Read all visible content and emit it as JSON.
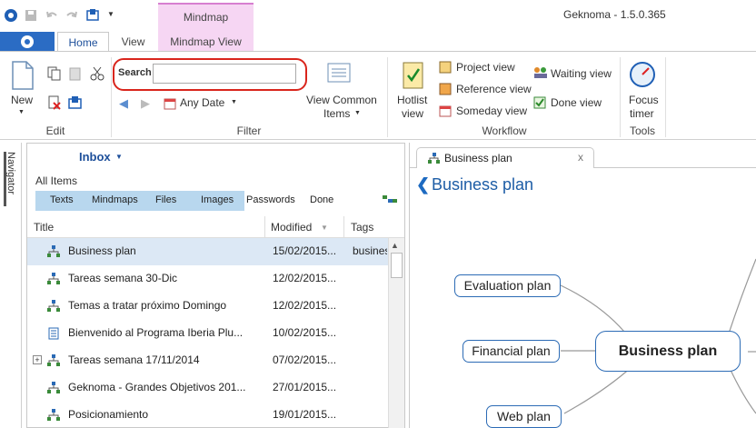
{
  "app": {
    "title": "Geknoma - 1.5.0.365",
    "context_group": "Mindmap"
  },
  "tabs": {
    "home": "Home",
    "view": "View",
    "mindmap_view": "Mindmap View"
  },
  "ribbon": {
    "new_label": "New",
    "edit_group": "Edit",
    "search_label": "Search",
    "search_value": "",
    "any_date": "Any Date",
    "view_common_items_line1": "View Common",
    "view_common_items_line2": "Items",
    "filter_group": "Filter",
    "hotlist_line1": "Hotlist",
    "hotlist_line2": "view",
    "project_view": "Project view",
    "reference_view": "Reference view",
    "someday_view": "Someday view",
    "waiting_view": "Waiting view",
    "done_view": "Done view",
    "workflow_group": "Workflow",
    "focus_line1": "Focus",
    "focus_line2": "timer",
    "tools_group": "Tools"
  },
  "navigator": {
    "label": "Navigator"
  },
  "list": {
    "inbox": "Inbox",
    "all_items": "All Items",
    "filters": [
      "Texts",
      "Mindmaps",
      "Files",
      "Images",
      "Passwords",
      "Done"
    ],
    "columns": {
      "title": "Title",
      "modified": "Modified",
      "tags": "Tags"
    },
    "rows": [
      {
        "title": "Business plan",
        "modified": "15/02/2015...",
        "tags": "busines",
        "icon": "mindmap-icon",
        "selected": true
      },
      {
        "title": "Tareas semana 30-Dic",
        "modified": "12/02/2015...",
        "tags": "",
        "icon": "mindmap-icon"
      },
      {
        "title": "Temas a tratar próximo Domingo",
        "modified": "12/02/2015...",
        "tags": "",
        "icon": "mindmap-icon"
      },
      {
        "title": "Bienvenido al Programa Iberia Plu...",
        "modified": "10/02/2015...",
        "tags": "",
        "icon": "document-icon"
      },
      {
        "title": "Tareas semana 17/11/2014",
        "modified": "07/02/2015...",
        "tags": "",
        "icon": "mindmap-icon",
        "expandable": true
      },
      {
        "title": "Geknoma - Grandes Objetivos 201...",
        "modified": "27/01/2015...",
        "tags": "",
        "icon": "mindmap-icon"
      },
      {
        "title": "Posicionamiento",
        "modified": "19/01/2015...",
        "tags": "",
        "icon": "mindmap-icon"
      }
    ]
  },
  "map": {
    "tab_label": "Business plan",
    "close_glyph": "x",
    "heading": "Business plan",
    "nodes": {
      "center": "Business plan",
      "evaluation": "Evaluation plan",
      "financial": "Financial plan",
      "web": "Web plan"
    }
  },
  "colors": {
    "accent": "#2b6cc4",
    "context_pink": "#f6d6f3",
    "search_highlight": "#d9251c",
    "filter_bar": "#b8d7ee"
  }
}
